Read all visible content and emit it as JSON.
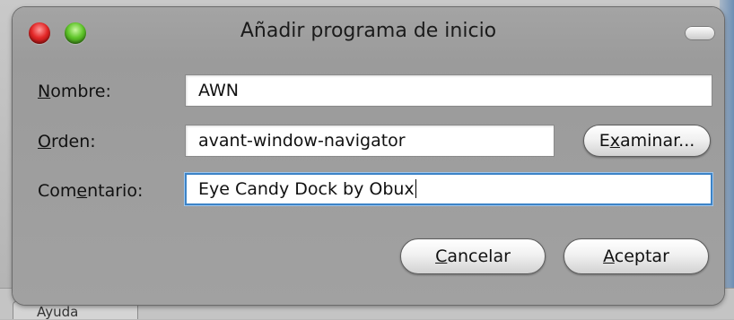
{
  "dialog": {
    "title": "Añadir programa de inicio"
  },
  "form": {
    "nombre": {
      "label_pre": "",
      "label_mnemonic": "N",
      "label_post": "ombre:",
      "value": "AWN"
    },
    "orden": {
      "label_pre": "",
      "label_mnemonic": "O",
      "label_post": "rden:",
      "value": "avant-window-navigator",
      "browse_pre": "E",
      "browse_mnemonic": "x",
      "browse_post": "aminar..."
    },
    "comentario": {
      "label_pre": "Com",
      "label_mnemonic": "e",
      "label_post": "ntario:",
      "value": "Eye Candy Dock by Obux"
    }
  },
  "buttons": {
    "cancel": {
      "pre": "",
      "mnemonic": "C",
      "post": "ancelar"
    },
    "accept": {
      "pre": "",
      "mnemonic": "A",
      "post": "ceptar"
    }
  },
  "background": {
    "tab_label": "Ayuda"
  },
  "colors": {
    "dialog_bg": "#a1a1a1",
    "focus_ring": "#3c83c7",
    "close_button": "#e32828",
    "maximize_button": "#5fc52a"
  }
}
